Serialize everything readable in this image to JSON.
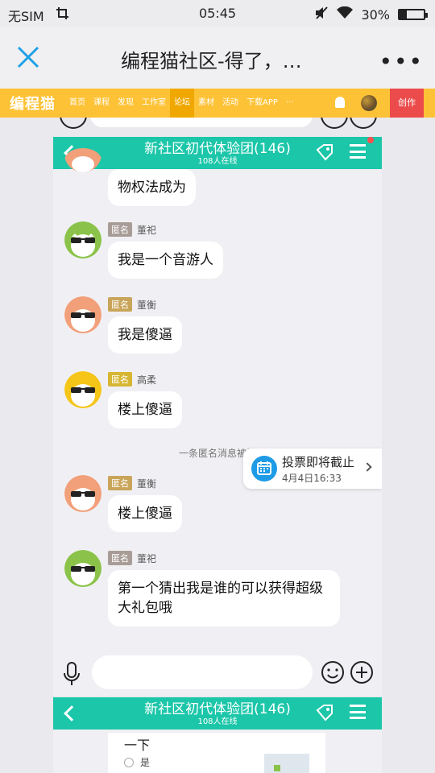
{
  "status_bar": {
    "carrier": "无SIM",
    "time": "05:45",
    "battery": "30%"
  },
  "title_bar": {
    "title": "编程猫社区-得了，…",
    "more": "•••"
  },
  "site_nav": {
    "logo": "编程猫",
    "links": [
      "首页",
      "课程",
      "发现",
      "工作室",
      "论坛",
      "素材",
      "活动",
      "下载APP",
      "···"
    ],
    "active_index": 4,
    "create": "创作"
  },
  "chat": {
    "group_name": "新社区初代体验团(146)",
    "online": "108人在线",
    "messages": [
      {
        "text": "物权法成为"
      },
      {
        "badge": "匿名",
        "badge_color": "#a89d96",
        "user": "董祀",
        "text": "我是一个音游人",
        "avatar_bg": "#8bc34a"
      },
      {
        "badge": "匿名",
        "badge_color": "#c9a55a",
        "user": "董衡",
        "text": "我是傻逼",
        "avatar_bg": "#f2a07a"
      },
      {
        "badge": "匿名",
        "badge_color": "#d6b632",
        "user": "高柔",
        "text": "楼上傻逼",
        "avatar_bg": "#f5c518"
      },
      {
        "badge": "匿名",
        "badge_color": "#c9a55a",
        "user": "董衡",
        "text": "楼上傻逼",
        "avatar_bg": "#f2a07a"
      },
      {
        "badge": "匿名",
        "badge_color": "#a89d96",
        "user": "董祀",
        "text": "第一个猜出我是谁的可以获得超级大礼包哦",
        "avatar_bg": "#8bc34a"
      }
    ],
    "system_notice": "一条匿名消息被撤",
    "vote": {
      "title": "投票即将截止",
      "date": "4月4日16:33"
    }
  },
  "chat2": {
    "group_name": "新社区初代体验团(146)",
    "online": "108人在线",
    "card_title": "一下",
    "option": "是"
  },
  "colors": {
    "accent": "#1cc6a9",
    "nav": "#fdc236",
    "create": "#ec4b4b"
  }
}
